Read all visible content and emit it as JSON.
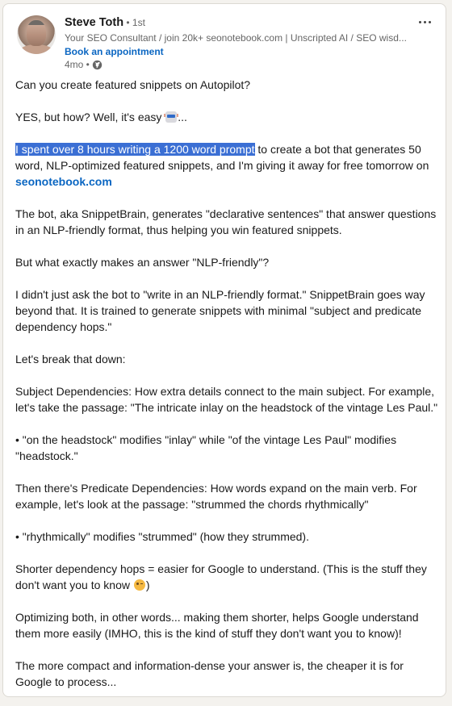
{
  "post": {
    "author": {
      "name": "Steve Toth",
      "degree": " • 1st",
      "headline": "Your SEO Consultant / join 20k+ seonotebook.com | Unscripted AI / SEO wisd...",
      "cta_label": "Book an appointment",
      "avatar_icon": "profile-photo"
    },
    "meta": {
      "age": "4mo •",
      "visibility_icon": "globe-icon"
    },
    "more_icon": "ellipsis-icon",
    "colors": {
      "link": "#0a66c2",
      "highlight": "#3b6fd4",
      "page_bg": "#f4f2ee"
    },
    "paragraphs": {
      "p1": "Can you create featured snippets on Autopilot?",
      "p2_before": "YES, but how? Well, it's easy ",
      "p2_emoji": "robot-emoji",
      "p2_after": "...",
      "p3_highlight": "I spent over 8 hours writing a 1200 word prompt",
      "p3_rest": " to create a bot that generates 50 word, NLP-optimized featured snippets, and I'm giving it away for free tomorrow on ",
      "p3_link": "seonotebook.com",
      "p4": "The bot, aka SnippetBrain, generates \"declarative sentences\" that answer questions in an NLP-friendly format, thus helping you win featured snippets.",
      "p5": "But what exactly makes an answer \"NLP-friendly\"?",
      "p6": "I didn't just ask the bot to \"write in an NLP-friendly format.\" SnippetBrain goes way beyond that. It is trained to generate snippets with minimal \"subject and predicate dependency hops.\"",
      "p7": "Let's break that down:",
      "p8": "Subject Dependencies: How extra details connect to the main subject. For example, let's take the passage: \"The intricate inlay on the headstock of the vintage Les Paul.\"",
      "p9": "• \"on the headstock\" modifies \"inlay\" while \"of the vintage Les Paul\" modifies \"headstock.\"",
      "p10": "Then there's Predicate Dependencies: How words expand on the main verb. For example, let's look at the passage: \"strummed the chords rhythmically\"",
      "p11": "• \"rhythmically\" modifies \"strummed\" (how they strummed).",
      "p12_before": "Shorter dependency hops = easier for Google to understand. (This is the stuff they don't want you to know ",
      "p12_emoji": "winking-face-emoji",
      "p12_after": ")",
      "p13": "Optimizing both, in other words... making them shorter, helps Google understand them more easily (IMHO, this is the kind of stuff they don't want you to know)!",
      "p14": "The more compact and information-dense your answer is, the cheaper it is for Google to process..."
    }
  }
}
